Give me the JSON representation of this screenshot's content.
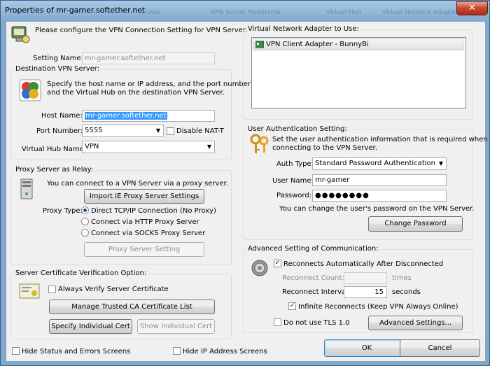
{
  "window": {
    "title": "Properties of mr-gamer.softether.net",
    "close_label": "✕",
    "background_tabs": [
      "Status",
      "VPN Server Hostname",
      "Virtual Hub",
      "Virtual Network Adapter"
    ]
  },
  "intro": {
    "text": "Please configure the VPN Connection Setting for VPN Server."
  },
  "setting_name": {
    "label": "Setting Name:",
    "value": "mr-gamer.softether.net"
  },
  "destination": {
    "group_label": "Destination VPN Server:",
    "description": [
      "Specify the host name or IP address, and the port number",
      "and the Virtual Hub on the destination VPN Server."
    ],
    "host_label": "Host Name:",
    "host_value": "mr-gamer.softether.net",
    "port_label": "Port Number:",
    "port_value": "5555",
    "disable_natt_label": "Disable NAT-T",
    "hub_label": "Virtual Hub Name:",
    "hub_value": "VPN"
  },
  "proxy": {
    "group_label": "Proxy Server as Relay:",
    "description": "You can connect to a VPN Server via a proxy server.",
    "import_button": "Import IE Proxy Server Settings",
    "type_label": "Proxy Type:",
    "options": [
      "Direct TCP/IP Connection (No Proxy)",
      "Connect via HTTP Proxy Server",
      "Connect via SOCKS Proxy Server"
    ],
    "selected_option": "Direct TCP/IP Connection (No Proxy)",
    "setting_button": "Proxy Server Setting"
  },
  "certificate": {
    "group_label": "Server Certificate Verification Option:",
    "always_verify_label": "Always Verify Server Certificate",
    "manage_button": "Manage Trusted CA Certificate List",
    "specify_button": "Specify Individual Cert",
    "show_button": "Show Individual Cert"
  },
  "bottom": {
    "hide_status_label": "Hide Status and Errors Screens",
    "hide_ip_label": "Hide IP Address Screens",
    "ok_button": "OK",
    "cancel_button": "Cancel"
  },
  "adapter": {
    "group_label": "Virtual Network Adapter to Use:",
    "items": [
      "VPN Client Adapter - BunnyBi"
    ]
  },
  "auth": {
    "group_label": "User Authentication Setting:",
    "description": [
      "Set the user authentication information that is required when",
      "connecting to the VPN Server."
    ],
    "type_label": "Auth Type:",
    "type_value": "Standard Password Authentication",
    "username_label": "User Name:",
    "username_value": "mr-gamer",
    "password_label": "Password:",
    "password_value": "●●●●●●●●",
    "change_note": "You can change the user's password on the VPN Server.",
    "change_button": "Change Password"
  },
  "advanced": {
    "group_label": "Advanced Setting of Communication:",
    "reconnect_label": "Reconnects Automatically After Disconnected",
    "reconnect_count_label": "Reconnect Count:",
    "reconnect_count_value": "",
    "times_label": "times",
    "interval_label": "Reconnect Interval:",
    "interval_value": "15",
    "seconds_label": "seconds",
    "infinite_label": "Infinite Reconnects (Keep VPN Always Online)",
    "no_tls_label": "Do not use TLS 1.0",
    "advanced_button": "Advanced Settings..."
  },
  "checked": {
    "disable_natt": false,
    "always_verify": false,
    "hide_status": false,
    "hide_ip": false,
    "reconnect": true,
    "infinite": true,
    "no_tls": false
  }
}
